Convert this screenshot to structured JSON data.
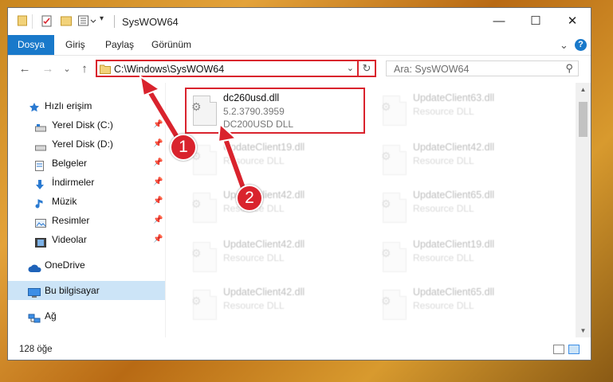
{
  "window": {
    "title": "SysWOW64",
    "controls": {
      "minimize": "—",
      "maximize": "☐",
      "close": "✕"
    }
  },
  "ribbon": {
    "tabs": [
      {
        "label": "Dosya"
      },
      {
        "label": "Giriş"
      },
      {
        "label": "Paylaş"
      },
      {
        "label": "Görünüm"
      }
    ],
    "expand": "⌄",
    "help": "?"
  },
  "navigation": {
    "back": "←",
    "forward": "→",
    "recent": "⌄",
    "up": "↑",
    "address": "C:\\Windows\\SysWOW64",
    "address_dropdown": "⌄",
    "refresh": "↻",
    "search_placeholder": "Ara: SysWOW64",
    "search_icon": "⚲"
  },
  "sidebar": {
    "quick_access": "Hızlı erişim",
    "items": [
      {
        "label": "Yerel Disk (C:)"
      },
      {
        "label": "Yerel Disk (D:)"
      },
      {
        "label": "Belgeler"
      },
      {
        "label": "İndirmeler"
      },
      {
        "label": "Müzik"
      },
      {
        "label": "Resimler"
      },
      {
        "label": "Videolar"
      }
    ],
    "onedrive": "OneDrive",
    "this_pc": "Bu bilgisayar",
    "network": "Ağ"
  },
  "files": [
    {
      "name": "dc260usd.dll",
      "line1": "5.2.3790.3959",
      "line2": "DC200USD DLL",
      "highlighted": true
    },
    {
      "name": "UpdateClient63.dll",
      "line1": "Resource DLL"
    },
    {
      "name": "UpdateClient19.dll",
      "line1": "Resource DLL"
    },
    {
      "name": "UpdateClient42.dll",
      "line1": "Resource DLL"
    },
    {
      "name": "UpdateClient42.dll",
      "line1": "Resource DLL"
    },
    {
      "name": "UpdateClient65.dll",
      "line1": "Resource DLL"
    },
    {
      "name": "UpdateClient42.dll",
      "line1": "Resource DLL"
    },
    {
      "name": "UpdateClient19.dll",
      "line1": "Resource DLL"
    },
    {
      "name": "UpdateClient42.dll",
      "line1": "Resource DLL"
    },
    {
      "name": "UpdateClient65.dll",
      "line1": "Resource DLL"
    }
  ],
  "status": {
    "count": "128 öğe"
  },
  "callouts": {
    "one": "1",
    "two": "2"
  },
  "colors": {
    "accent": "#1979ca",
    "highlight": "#d9232d",
    "selected": "#cce4f7"
  }
}
